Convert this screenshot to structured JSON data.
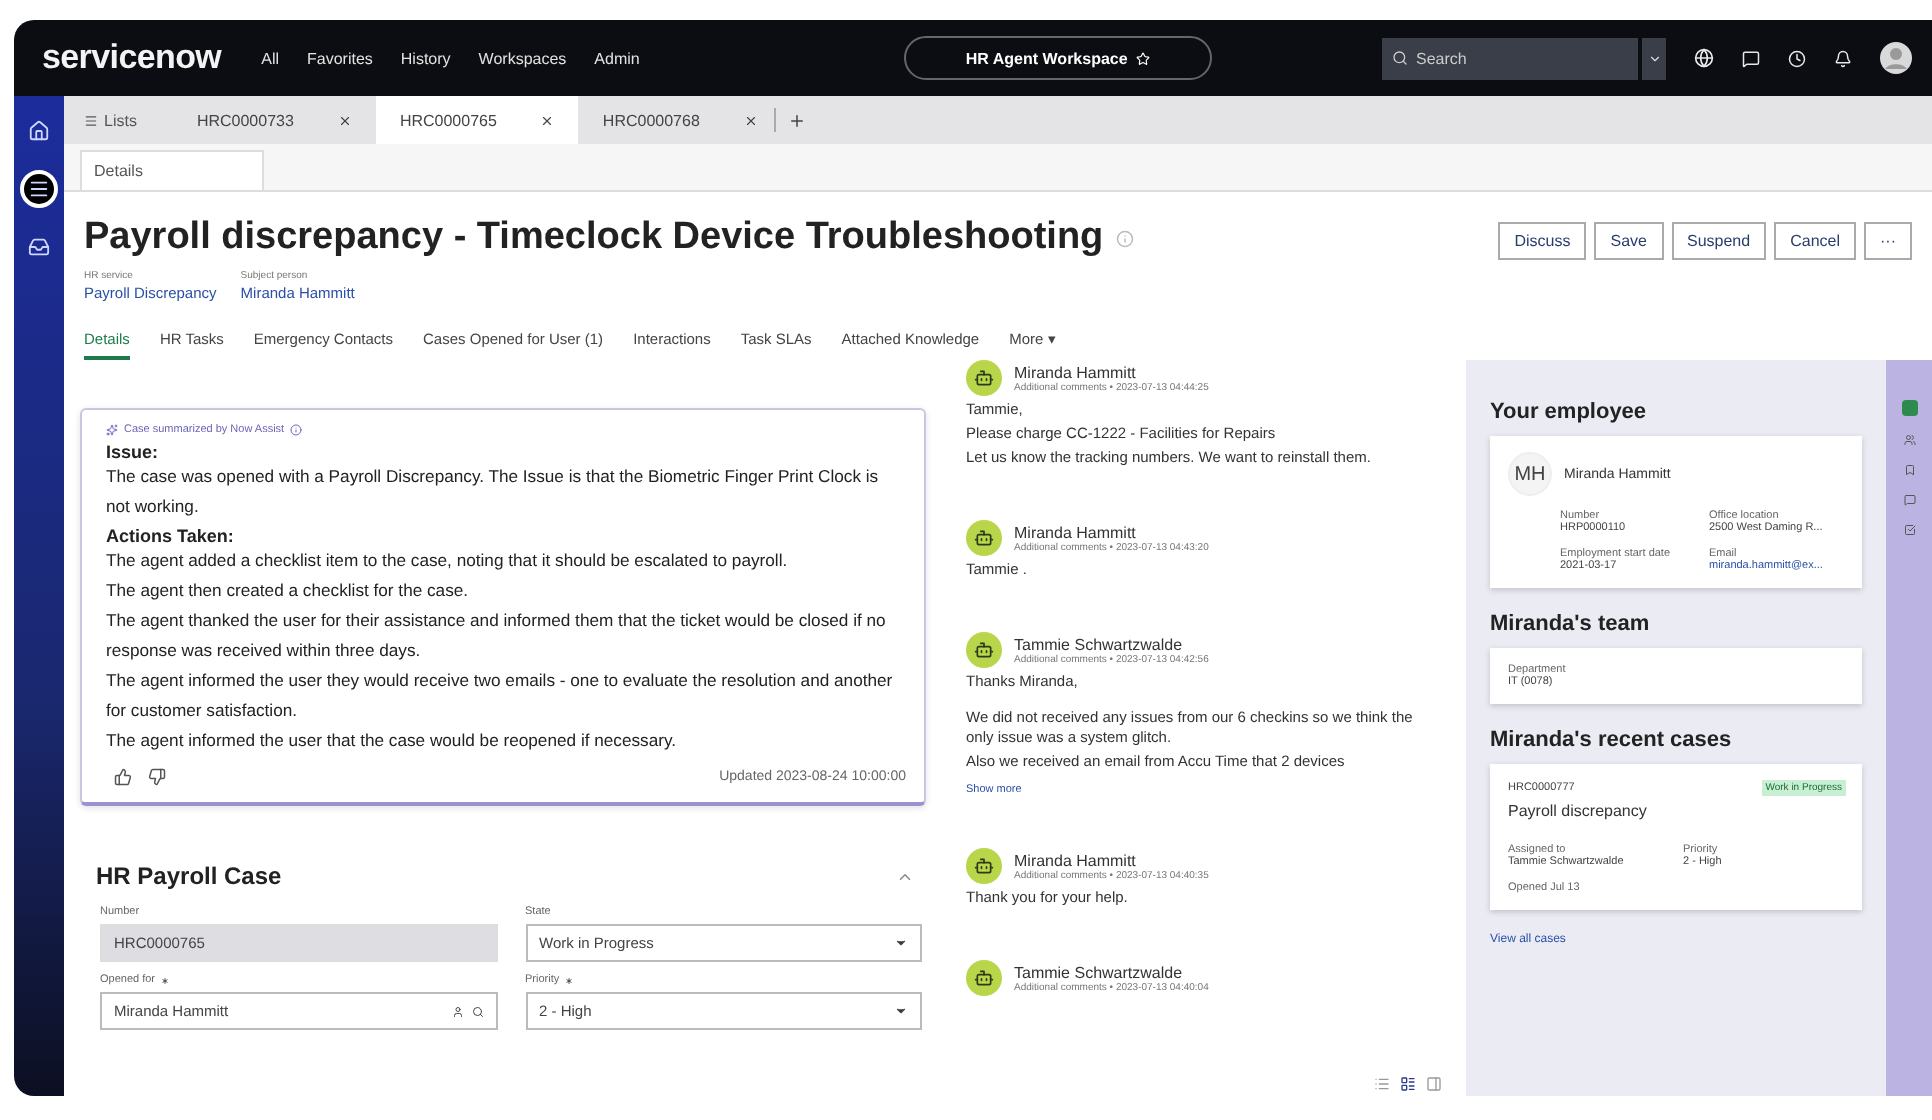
{
  "nav": {
    "logo": "servicenow",
    "menu": [
      "All",
      "Favorites",
      "History",
      "Workspaces",
      "Admin"
    ],
    "workspace": "HR Agent Workspace",
    "search": {
      "placeholder": "Search"
    }
  },
  "rail": [
    {
      "kind": "home",
      "selected": false
    },
    {
      "kind": "list",
      "selected": true
    },
    {
      "kind": "inbox",
      "selected": false
    }
  ],
  "tab_bar": {
    "lists": "Lists",
    "tabs": [
      {
        "label": "HRC0000733",
        "selected": false
      },
      {
        "label": "HRC0000765",
        "selected": true
      },
      {
        "label": "HRC0000768",
        "selected": false
      }
    ]
  },
  "subtabs": [
    {
      "label": "Details",
      "selected": true
    }
  ],
  "record": {
    "title": "Payroll discrepancy - Timeclock Device Troubleshooting",
    "fields": [
      {
        "label": "HR service",
        "value": "Payroll Discrepancy"
      },
      {
        "label": "Subject person",
        "value": "Miranda Hammitt"
      }
    ],
    "buttons": [
      "Discuss",
      "Save",
      "Suspend",
      "Cancel",
      "···"
    ]
  },
  "record_tabs": [
    {
      "label": "Details",
      "selected": true
    },
    {
      "label": "HR Tasks",
      "selected": false
    },
    {
      "label": "Emergency Contacts",
      "selected": false
    },
    {
      "label": "Cases Opened for User (1)",
      "selected": false
    },
    {
      "label": "Interactions",
      "selected": false
    },
    {
      "label": "Task SLAs",
      "selected": false
    },
    {
      "label": "Attached Knowledge",
      "selected": false
    },
    {
      "label": "More ▾",
      "selected": false
    }
  ],
  "summary": {
    "caption": "Case summarized by Now Assist",
    "sections": [
      {
        "heading": "Issue:",
        "lines": [
          "The case was opened with a Payroll Discrepancy. The Issue is that the Biometric Finger Print Clock is not working."
        ]
      },
      {
        "heading": "Actions Taken:",
        "lines": [
          "The agent added a checklist item to the case, noting that it should be escalated to payroll.",
          "The agent then created a checklist for the case.",
          "The agent thanked the user for their assistance and informed them that the ticket would be closed if no response was received within three days.",
          "The agent informed the user they would receive two emails - one to evaluate the resolution and another for customer satisfaction.",
          "The agent informed the user that the case would be reopened if necessary."
        ]
      }
    ],
    "updated": "Updated 2023-08-24 10:00:00"
  },
  "form": {
    "title": "HR Payroll Case",
    "expanded": true,
    "fields": [
      {
        "label": "Number",
        "value": "HRC0000765",
        "kind": "readonly",
        "required": false
      },
      {
        "label": "State",
        "value": "Work in Progress",
        "kind": "select",
        "required": false
      },
      {
        "label": "Opened for",
        "value": "Miranda Hammitt",
        "kind": "lookup",
        "required": true
      },
      {
        "label": "Priority",
        "value": "2 - High",
        "kind": "select",
        "required": true
      }
    ]
  },
  "activity": {
    "entries": [
      {
        "author": "Miranda Hammitt",
        "meta": "Additional comments • 2023-07-13 04:44:25",
        "body": [
          "Tammie,",
          "Please charge CC-1222 - Facilities for Repairs",
          "Let us know the tracking numbers. We want to reinstall them."
        ]
      },
      {
        "author": "Miranda Hammitt",
        "meta": "Additional comments • 2023-07-13 04:43:20",
        "body": [
          "Tammie ."
        ]
      },
      {
        "author": "Tammie Schwartzwalde",
        "meta": "Additional comments • 2023-07-13 04:42:56",
        "body": [
          "Thanks Miranda,",
          "We did not received any issues from our 6 checkins so we think the only issue was a system glitch.",
          "Also we received an email from Accu Time that 2 devices"
        ],
        "more": "Show more"
      },
      {
        "author": "Miranda Hammitt",
        "meta": "Additional comments • 2023-07-13 04:40:35",
        "body": [
          "Thank you for your help."
        ]
      },
      {
        "author": "Tammie Schwartzwalde",
        "meta": "Additional comments • 2023-07-13 04:40:04"
      }
    ],
    "view_modes": [
      {
        "kind": "list",
        "selected": false
      },
      {
        "kind": "compact",
        "selected": true
      },
      {
        "kind": "panel",
        "selected": false
      }
    ]
  },
  "employee": {
    "title": "Your employee",
    "initials": "MH",
    "name": "Miranda Hammitt",
    "fields": [
      {
        "label": "Number",
        "value": "HRP0000110",
        "link": false
      },
      {
        "label": "Office location",
        "value": "2500 West Daming R...",
        "link": false
      },
      {
        "label": "Employment start date",
        "value": "2021-03-17",
        "link": false
      },
      {
        "label": "Email",
        "value": "miranda.hammitt@ex...",
        "link": true
      }
    ]
  },
  "team": {
    "title": "Miranda's team",
    "fields": [
      {
        "label": "Department",
        "value": "IT (0078)"
      }
    ]
  },
  "recent_cases": {
    "title": "Miranda's recent cases",
    "cases": [
      {
        "number": "HRC0000777",
        "state": "Work in Progress",
        "title": "Payroll discrepancy",
        "fields": [
          {
            "label": "Assigned to",
            "value": "Tammie Schwartzwalde"
          },
          {
            "label": "Priority",
            "value": "2 - High"
          }
        ],
        "opened": "Opened Jul 13"
      }
    ],
    "link": "View all cases"
  }
}
